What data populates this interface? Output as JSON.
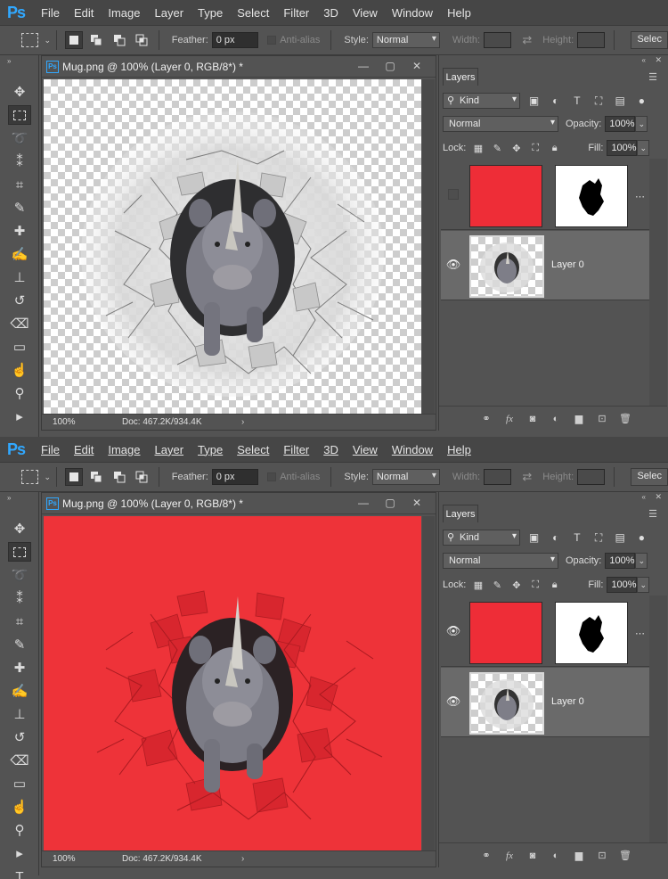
{
  "menu": [
    "File",
    "Edit",
    "Image",
    "Layer",
    "Type",
    "Select",
    "Filter",
    "3D",
    "View",
    "Window",
    "Help"
  ],
  "logo": "Ps",
  "options": {
    "feather_label": "Feather:",
    "feather_value": "0 px",
    "antialias_label": "Anti-alias",
    "style_label": "Style:",
    "style_value": "Normal",
    "width_label": "Width:",
    "height_label": "Height:",
    "right_button": "Selec"
  },
  "document": {
    "title": "Mug.png @ 100% (Layer 0, RGB/8*) *",
    "zoom": "100%",
    "doc_info": "Doc: 467.2K/934.4K"
  },
  "layers_panel": {
    "tab": "Layers",
    "filter_kind": "Kind",
    "blend_mode": "Normal",
    "opacity_label": "Opacity:",
    "opacity_value": "100%",
    "lock_label": "Lock:",
    "fill_label": "Fill:",
    "fill_value": "100%",
    "layer0_name": "Layer 0",
    "fill_color": "#ee2d37"
  },
  "states": {
    "top": {
      "fill_layer_visible": false,
      "canvas_background": "transparent"
    },
    "bottom": {
      "fill_layer_visible": true,
      "canvas_background": "#ee3339"
    }
  },
  "icons": {
    "tools": [
      "move-icon",
      "marquee-icon",
      "lasso-icon",
      "magic-wand-icon",
      "crop-icon",
      "eyedropper-icon",
      "healing-icon",
      "brush-icon",
      "stamp-icon",
      "history-brush-icon",
      "eraser-icon",
      "gradient-icon",
      "smudge-icon",
      "dodge-icon",
      "path-select-icon",
      "type-icon"
    ],
    "layer_footer": [
      "link-icon",
      "fx-icon",
      "mask-icon",
      "adjustment-icon",
      "folder-icon",
      "new-layer-icon",
      "trash-icon"
    ]
  }
}
